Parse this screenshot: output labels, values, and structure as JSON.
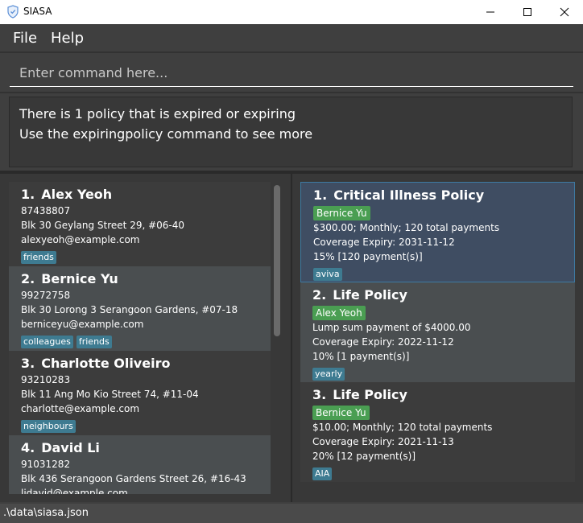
{
  "window": {
    "title": "SIASA"
  },
  "menu": {
    "file": "File",
    "help": "Help"
  },
  "command": {
    "placeholder": "Enter command here..."
  },
  "result": {
    "line1": "There is 1 policy that is expired or expiring",
    "line2": "Use the expiringpolicy command to see more"
  },
  "persons": [
    {
      "index": "1.",
      "name": "Alex Yeoh",
      "phone": "87438807",
      "address": "Blk 30 Geylang Street 29, #06-40",
      "email": "alexyeoh@example.com",
      "tags": [
        "friends"
      ]
    },
    {
      "index": "2.",
      "name": "Bernice Yu",
      "phone": "99272758",
      "address": "Blk 30 Lorong 3 Serangoon Gardens, #07-18",
      "email": "berniceyu@example.com",
      "tags": [
        "colleagues",
        "friends"
      ]
    },
    {
      "index": "3.",
      "name": "Charlotte Oliveiro",
      "phone": "93210283",
      "address": "Blk 11 Ang Mo Kio Street 74, #11-04",
      "email": "charlotte@example.com",
      "tags": [
        "neighbours"
      ]
    },
    {
      "index": "4.",
      "name": "David Li",
      "phone": "91031282",
      "address": "Blk 436 Serangoon Gardens Street 26, #16-43",
      "email": "lidavid@example.com",
      "tags": []
    }
  ],
  "policies": [
    {
      "index": "1.",
      "name": "Critical Illness Policy",
      "owner": "Bernice Yu",
      "payment": "$300.00; Monthly; 120 total payments",
      "expiry": "Coverage Expiry: 2031-11-12",
      "commission": "15% [120 payment(s)]",
      "tags": [
        "aviva"
      ]
    },
    {
      "index": "2.",
      "name": "Life Policy",
      "owner": "Alex Yeoh",
      "payment": "Lump sum payment of $4000.00",
      "expiry": "Coverage Expiry: 2022-11-12",
      "commission": "10% [1 payment(s)]",
      "tags": [
        "yearly"
      ]
    },
    {
      "index": "3.",
      "name": "Life Policy",
      "owner": "Bernice Yu",
      "payment": "$10.00; Monthly; 120 total payments",
      "expiry": "Coverage Expiry: 2021-11-13",
      "commission": "20% [12 payment(s)]",
      "tags": [
        "AIA"
      ]
    }
  ],
  "status": {
    "path": ".\\data\\siasa.json"
  }
}
